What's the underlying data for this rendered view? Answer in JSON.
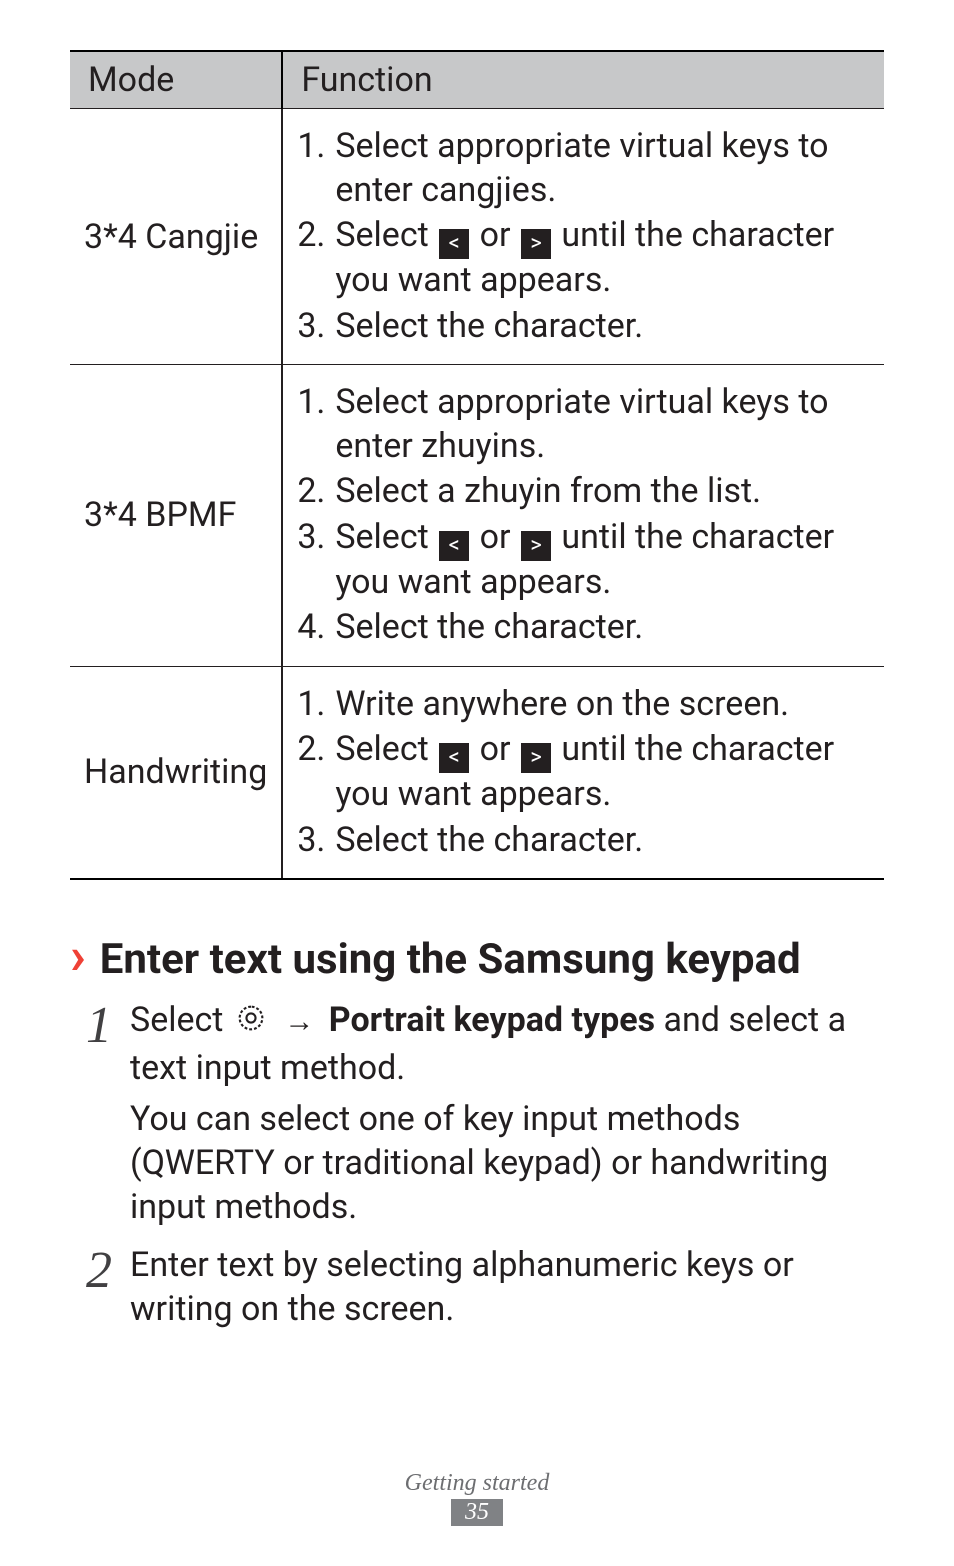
{
  "table": {
    "headers": [
      "Mode",
      "Function"
    ],
    "rows": [
      {
        "mode": "3*4 Cangjie",
        "steps": [
          {
            "n": "1.",
            "pre": "Select appropriate virtual keys to enter cangjies."
          },
          {
            "n": "2.",
            "pre": "Select ",
            "post": " until the character you want appears.",
            "icons": true
          },
          {
            "n": "3.",
            "pre": "Select the character."
          }
        ]
      },
      {
        "mode": "3*4 BPMF",
        "steps": [
          {
            "n": "1.",
            "pre": "Select appropriate virtual keys to enter zhuyins."
          },
          {
            "n": "2.",
            "pre": "Select a zhuyin from the list."
          },
          {
            "n": "3.",
            "pre": "Select ",
            "post": " until the character you want appears.",
            "icons": true
          },
          {
            "n": "4.",
            "pre": "Select the character."
          }
        ]
      },
      {
        "mode": "Handwriting",
        "steps": [
          {
            "n": "1.",
            "pre": "Write anywhere on the screen."
          },
          {
            "n": "2.",
            "pre": "Select ",
            "post": " until the character you want appears.",
            "icons": true
          },
          {
            "n": "3.",
            "pre": "Select the character."
          }
        ]
      }
    ]
  },
  "or_word": "or",
  "section": {
    "title": "Enter text using the Samsung keypad",
    "items": [
      {
        "n": "1",
        "pre": "Select ",
        "arrow": "→",
        "bold": "Portrait keypad types",
        "post": " and select a text input method.",
        "sub": "You can select one of key input methods (QWERTY or traditional keypad) or handwriting input methods."
      },
      {
        "n": "2",
        "pre": "Enter text by selecting alphanumeric keys or writing on the screen."
      }
    ]
  },
  "footer": {
    "text": "Getting started",
    "page": "35"
  }
}
